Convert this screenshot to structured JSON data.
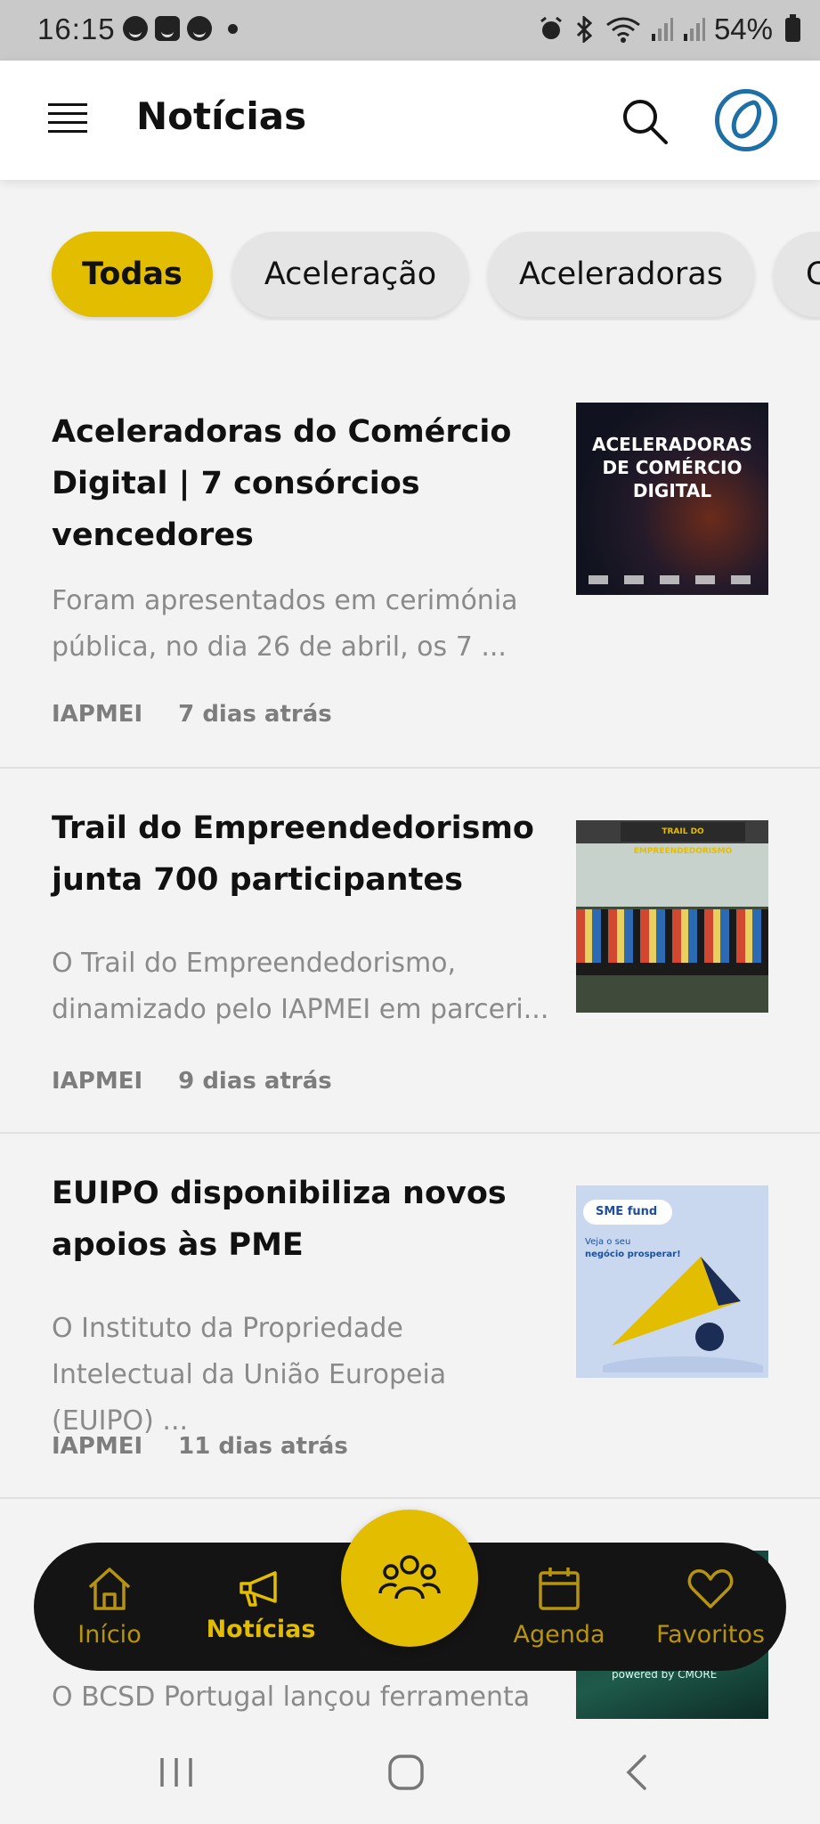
{
  "status_bar": {
    "time": "16:15",
    "battery": "54%"
  },
  "app_bar": {
    "title": "Notícias"
  },
  "filters": [
    {
      "label": "Todas",
      "active": true
    },
    {
      "label": "Aceleração",
      "active": false
    },
    {
      "label": "Aceleradoras",
      "active": false
    },
    {
      "label": "C",
      "active": false
    }
  ],
  "articles": [
    {
      "title": "Aceleradoras do Comércio Digital | 7 consórcios vencedores",
      "description": "Foram apresentados em cerimónia pública, no dia 26 de abril, os 7 ...",
      "source": "IAPMEI",
      "time": "7 dias atrás",
      "image_text": "ACELERADORAS DE COMÉRCIO DIGITAL"
    },
    {
      "title": "Trail do Empreendedorismo junta 700 participantes",
      "description": "O Trail do Empreendedorismo, dinamizado pelo IAPMEI em parceri...",
      "source": "IAPMEI",
      "time": "9 dias atrás",
      "image_text": "TRAIL DO EMPREENDEDORISMO"
    },
    {
      "title": "EUIPO disponibiliza novos apoios às PME",
      "description": "O Instituto da Propriedade Intelectual da União Europeia (EUIPO) ...",
      "source": "IAPMEI",
      "time": "11 dias atrás",
      "image_text_1": "SME fund",
      "image_text_2": "Veja o seu",
      "image_text_3": "negócio prosperar!"
    },
    {
      "description": "O BCSD Portugal lançou ferramenta",
      "image_text": "powered by CMORE"
    }
  ],
  "bottom_nav": [
    {
      "label": "Início",
      "icon": "home-icon",
      "active": false
    },
    {
      "label": "Notícias",
      "icon": "megaphone-icon",
      "active": true
    },
    {
      "label": "Agenda",
      "icon": "calendar-icon",
      "active": false
    },
    {
      "label": "Favoritos",
      "icon": "heart-icon",
      "active": false
    }
  ],
  "fab": {
    "icon": "community-icon"
  },
  "colors": {
    "accent": "#e3bd00",
    "nav_bg": "#141414",
    "muted": "#8a8a8a",
    "logo": "#1d6fa5"
  }
}
